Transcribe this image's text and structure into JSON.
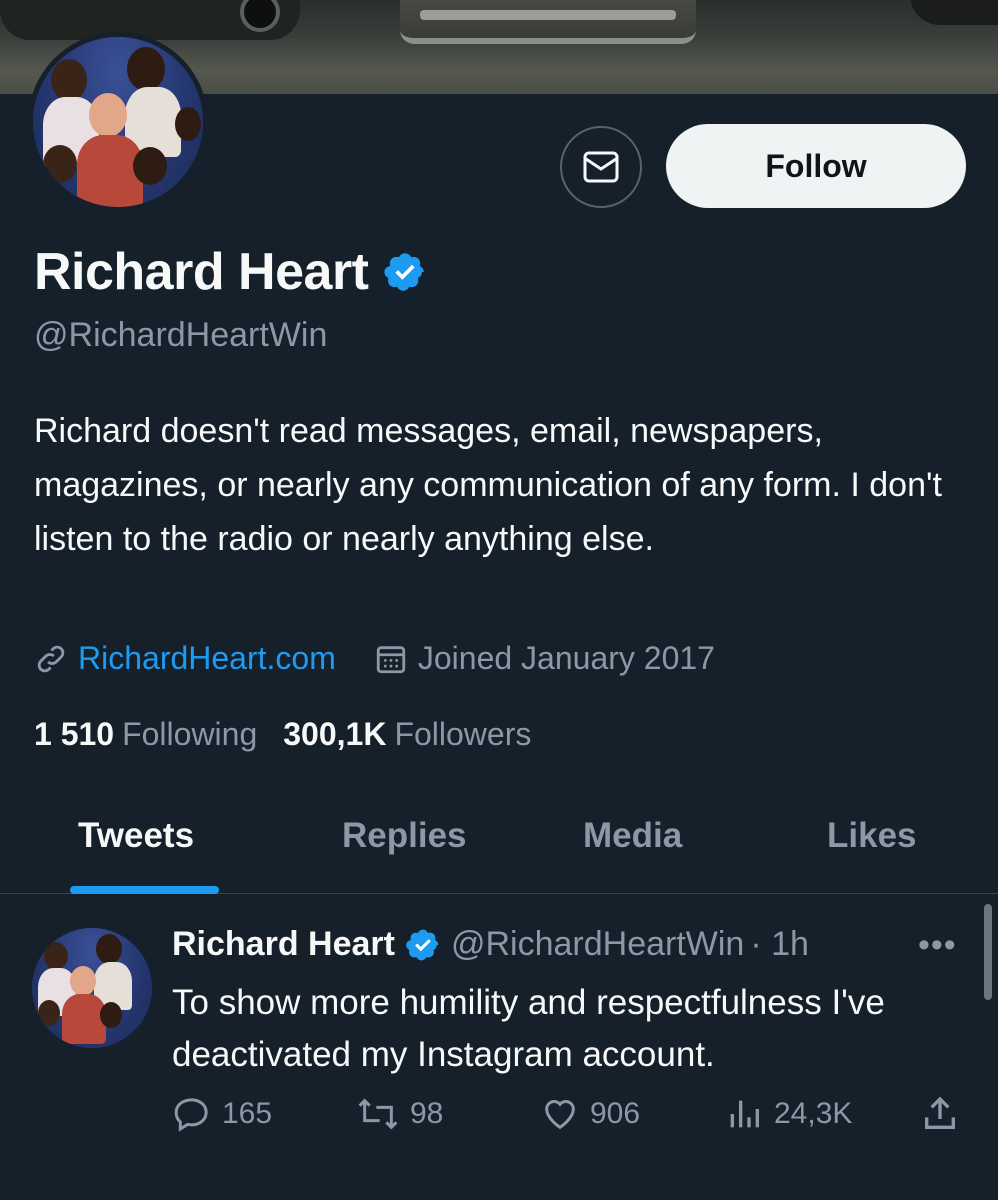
{
  "profile": {
    "name": "Richard Heart",
    "handle": "@RichardHeartWin",
    "bio": "Richard doesn't read messages, email, newspapers, magazines, or nearly any communication of any form. I don't listen to the radio or nearly anything else.",
    "website": "RichardHeart.com",
    "joined": "Joined January 2017",
    "following_count": "1 510",
    "following_label": "Following",
    "followers_count": "300,1K",
    "followers_label": "Followers"
  },
  "actions": {
    "follow_label": "Follow",
    "message_icon": "envelope-icon"
  },
  "tabs": [
    {
      "label": "Tweets",
      "active": true
    },
    {
      "label": "Replies",
      "active": false
    },
    {
      "label": "Media",
      "active": false
    },
    {
      "label": "Likes",
      "active": false
    }
  ],
  "tweet": {
    "author_name": "Richard Heart",
    "author_handle": "@RichardHeartWin",
    "time": "· 1h",
    "more": "•••",
    "text": "To show more humility and respectfulness I've deactivated my Instagram account.",
    "replies": "165",
    "retweets": "98",
    "likes": "906",
    "views": "24,3K"
  },
  "colors": {
    "background": "#15202b",
    "accent": "#1d9bf0",
    "secondary_text": "#8b98a5",
    "primary_text": "#f7f9f9",
    "follow_button_bg": "#eff3f4"
  }
}
